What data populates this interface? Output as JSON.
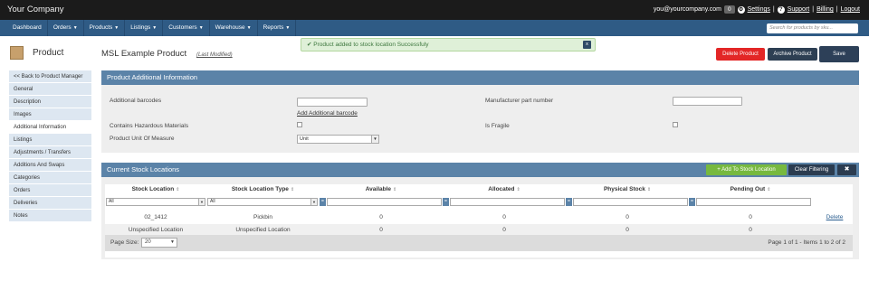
{
  "topbar": {
    "brand": "Your Company",
    "email": "you@yourcompany.com",
    "notif_count": "0",
    "settings": "Settings",
    "support": "Support",
    "billing": "Billing",
    "logout": "Logout"
  },
  "nav": {
    "items": [
      "Dashboard",
      "Orders",
      "Products",
      "Listings",
      "Customers",
      "Warehouse",
      "Reports"
    ],
    "search_placeholder": "Search for products by sku..."
  },
  "product_sidebar": {
    "title": "Product",
    "items": [
      "<< Back to Product Manager",
      "General",
      "Description",
      "Images",
      "Additional Information",
      "Listings",
      "Adjustments / Transfers",
      "Additions And Swaps",
      "Categories",
      "Orders",
      "Deliveries",
      "Notes"
    ]
  },
  "header": {
    "title": "MSL Example Product",
    "last_modified": "(Last Modified)",
    "toast": "Product added to stock location Successfuly",
    "toast_close": "x",
    "delete_label": "Delete Product",
    "archive_label": "Archive Product",
    "save_label": "Save"
  },
  "additional_info": {
    "title": "Product Additional Information",
    "additional_barcodes_label": "Additional barcodes",
    "add_barcode_link": "Add Additional barcode",
    "hazardous_label": "Contains Hazardous Materials",
    "uom_label": "Product Unit Of Measure",
    "uom_value": "Unit",
    "mpn_label": "Manufacturer part number",
    "fragile_label": "Is Fragile"
  },
  "stock_locations": {
    "title": "Current Stock Locations",
    "add_button": "Add To Stock Location",
    "clear_button": "Clear Filtering",
    "columns": [
      "Stock Location",
      "Stock Location Type",
      "Available",
      "Allocated",
      "Physical Stock",
      "Pending Out"
    ],
    "filters": {
      "location": "All",
      "type": "All"
    },
    "rows": [
      {
        "location": "02_1412",
        "type": "Pickbin",
        "available": "0",
        "allocated": "0",
        "physical": "0",
        "pending": "0",
        "action": "Delete"
      },
      {
        "location": "Unspecified Location",
        "type": "Unspecified Location",
        "available": "0",
        "allocated": "0",
        "physical": "0",
        "pending": "0",
        "action": ""
      }
    ],
    "page_size_label": "Page Size:",
    "page_size_value": "20",
    "page_info": "Page 1 of 1  -  Items 1 to 2 of 2"
  },
  "colors": {
    "topbar": "#1b1b1b",
    "nav": "#2f5b85",
    "panel_header": "#5b83a8",
    "delete": "#e32626",
    "add": "#77b93f",
    "success_bg": "#dff0d8"
  }
}
